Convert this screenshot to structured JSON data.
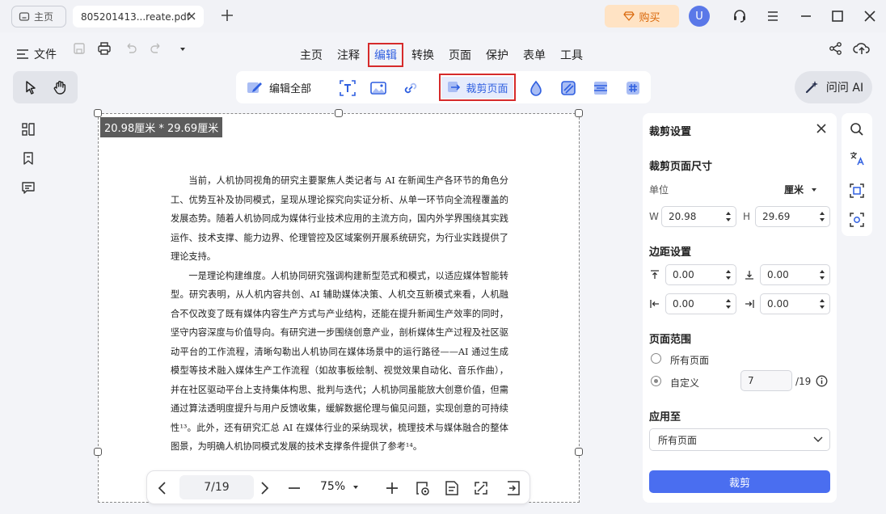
{
  "titlebar": {
    "home_tab": "主页",
    "doc_tab": "805201413...reate.pdf",
    "buy": "购买",
    "avatar_letter": "U"
  },
  "menubar": {
    "file": "文件",
    "items": [
      "主页",
      "注释",
      "编辑",
      "转换",
      "页面",
      "保护",
      "表单",
      "工具"
    ],
    "active_index": 2
  },
  "toolbar": {
    "edit_all": "编辑全部",
    "crop_page": "裁剪页面",
    "ask_ai": "问问 AI"
  },
  "document": {
    "dimension_label": "20.98厘米 * 29.69厘米",
    "paragraphs": [
      "当前，人机协同视角的研究主要聚焦人类记者与 AI 在新闻生产各环节的角色分工、优势互补及协同模式，呈现从理论探究向实证分析、从单一环节向全流程覆盖的发展态势。随着人机协同成为媒体行业技术应用的主流方向，国内外学界围绕其实践运作、技术支撑、能力边界、伦理管控及区域案例开展系统研究，为行业实践提供了理论支持。",
      "一是理论构建维度。人机协同研究强调构建新型范式和模式，以适应媒体智能转型。研究表明，从人机内容共创、AI 辅助媒体决策、人机交互新模式来看，人机融合不仅改变了既有媒体内容生产方式与产业结构，还能在提升新闻生产效率的同时，坚守内容深度与价值导向。有研究进一步围绕创意产业，剖析媒体生产过程及社区驱动平台的工作流程，清晰勾勒出人机协同在媒体场景中的运行路径——AI 通过生成模型等技术融入媒体生产工作流程（如故事板绘制、视觉效果自动化、音乐作曲），并在社区驱动平台上支持集体构思、批判与迭代；人机协同虽能放大创意价值，但需通过算法透明度提升与用户反馈收集，缓解数据伦理与偏见问题，实现创意的可持续性¹³。此外，还有研究汇总 AI 在媒体行业的采纳现状，梳理技术与媒体融合的整体图景，为明确人机协同模式发展的技术支撑条件提供了参考¹⁴。"
    ]
  },
  "bottom_nav": {
    "page": "7/19",
    "zoom": "75%"
  },
  "panel": {
    "title": "裁剪设置",
    "size_section": "裁剪页面尺寸",
    "unit_label": "单位",
    "unit_value": "厘米",
    "w_label": "W",
    "w_value": "20.98",
    "h_label": "H",
    "h_value": "29.69",
    "margin_section": "边距设置",
    "margin_top": "0.00",
    "margin_bottom": "0.00",
    "margin_left": "0.00",
    "margin_right": "0.00",
    "range_section": "页面范围",
    "all_pages": "所有页面",
    "custom": "自定义",
    "custom_value": "7",
    "total_pages": "/19",
    "range_selected": "custom",
    "apply_section": "应用至",
    "apply_value": "所有页面",
    "crop_button": "裁剪"
  },
  "colors": {
    "accent": "#2f5fe0",
    "highlight_border": "#d62b2b",
    "crop_button": "#4a6ef0",
    "buy_bg": "#ffe3c4",
    "buy_text": "#d9670a"
  }
}
